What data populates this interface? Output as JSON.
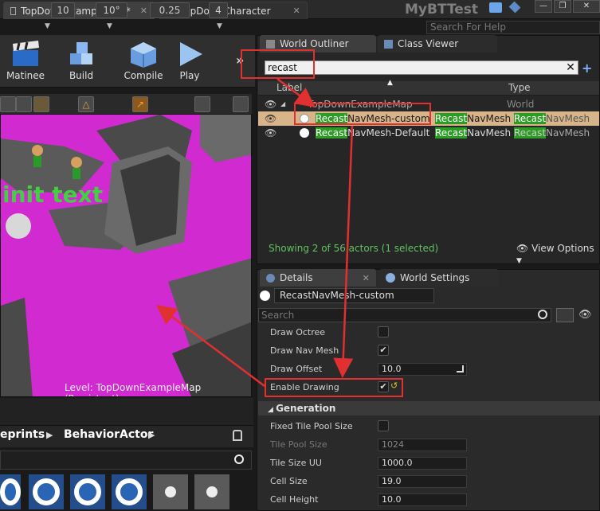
{
  "titlebar": {
    "tabs": [
      {
        "label": "TopDownExampleMap*",
        "active": true
      },
      {
        "label": "TopDownCharacter",
        "active": false
      }
    ],
    "project": "MyBTTest",
    "help_placeholder": "Search For Help"
  },
  "toolbar": {
    "buttons": [
      {
        "label": "Matinee",
        "icon": "clapperboard-icon"
      },
      {
        "label": "Build",
        "icon": "cubes-icon"
      },
      {
        "label": "Compile",
        "icon": "grid-cube-icon"
      },
      {
        "label": "Play",
        "icon": "play-icon"
      }
    ],
    "more": "»"
  },
  "viewport_toolbar": {
    "grid_value": "10",
    "rotation_value": "10°",
    "scale_value": "0.25",
    "camera_value": "4"
  },
  "viewport": {
    "overlay_text": "init text",
    "level_label": "Level:",
    "level_name": "TopDownExampleMap (Persistent)",
    "colors": {
      "floor": "#d02ad0"
    }
  },
  "content_browser": {
    "crumb1": "eprints",
    "crumb2": "BehaviorActor"
  },
  "outliner": {
    "tabs": [
      {
        "label": "World Outliner",
        "active": true
      },
      {
        "label": "Class Viewer",
        "active": false
      }
    ],
    "search_value": "recast",
    "col_label": "Label",
    "col_type": "Type",
    "rows": [
      {
        "label": "TopDownExampleMap",
        "type": "World",
        "selected": false,
        "level": 0
      },
      {
        "label_hl": "Recast",
        "label_rest": "NavMesh-custom",
        "type_hl1": "Recast",
        "type_mid": "NavMesh",
        "type_hl2": "Recast",
        "type_rest": "NavMesh",
        "selected": true,
        "level": 1
      },
      {
        "label_hl": "Recast",
        "label_rest": "NavMesh-Default",
        "type_hl1": "Recast",
        "type_mid": "NavMesh",
        "type_hl2": "Recast",
        "type_rest": "NavMesh",
        "selected": false,
        "level": 1
      }
    ],
    "status": "Showing 2 of 56 actors (1 selected)",
    "view_options": "View Options"
  },
  "details": {
    "tabs": [
      {
        "label": "Details",
        "active": true
      },
      {
        "label": "World Settings",
        "active": false
      }
    ],
    "actor_name": "RecastNavMesh-custom",
    "search_placeholder": "Search",
    "props": [
      {
        "label": "Draw Octree",
        "kind": "check",
        "checked": false
      },
      {
        "label": "Draw Nav Mesh",
        "kind": "check",
        "checked": true
      },
      {
        "label": "Draw Offset",
        "kind": "num",
        "value": "10.0"
      },
      {
        "label": "Enable Drawing",
        "kind": "check",
        "checked": true
      }
    ],
    "category": "Generation",
    "gen_props": [
      {
        "label": "Fixed Tile Pool Size",
        "kind": "check",
        "checked": false
      },
      {
        "label": "Tile Pool Size",
        "kind": "num",
        "value": "1024",
        "disabled": true
      },
      {
        "label": "Tile Size UU",
        "kind": "num",
        "value": "1000.0"
      },
      {
        "label": "Cell Size",
        "kind": "num",
        "value": "19.0"
      },
      {
        "label": "Cell Height",
        "kind": "num",
        "value": "10.0"
      }
    ]
  },
  "annotation_colors": {
    "highlight": "#e03030",
    "match": "#2c9c24"
  }
}
